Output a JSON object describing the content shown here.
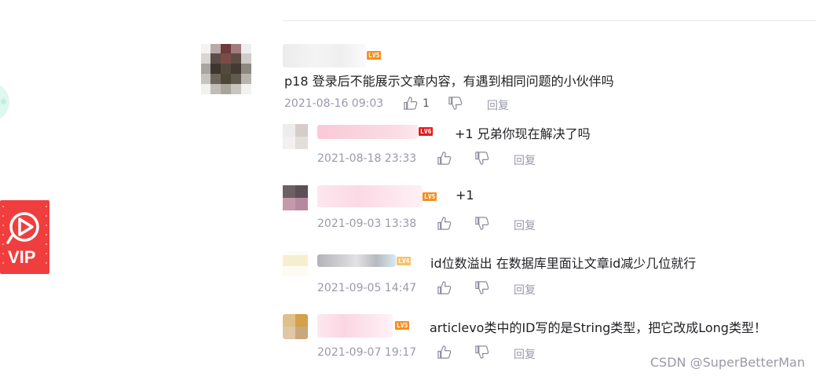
{
  "main_comment": {
    "level": "LV5",
    "text": "p18 登录后不能展示文章内容，有遇到相同问题的小伙伴吗",
    "date": "2021-08-16 09:03",
    "like_count": "1",
    "reply_label": "回复"
  },
  "replies": [
    {
      "level": "LV6",
      "text": "+1 兄弟你现在解决了吗",
      "date": "2021-08-18 23:33",
      "reply_label": "回复"
    },
    {
      "level": "LV5",
      "text": "+1",
      "date": "2021-09-03 13:38",
      "reply_label": "回复"
    },
    {
      "level": "LV4",
      "text": "id位数溢出 在数据库里面让文章id减少几位就行",
      "date": "2021-09-05 14:47",
      "reply_label": "回复"
    },
    {
      "level": "LV5",
      "text": "articlevo类中的ID写的是String类型，把它改成Long类型！",
      "date": "2021-09-07 19:17",
      "reply_label": "回复"
    }
  ],
  "vip": {
    "label": "VIP"
  },
  "watermark": "CSDN @SuperBetterMan",
  "colors": {
    "vip": "#f03e3e",
    "level_orange": "#f58f1f",
    "level_red": "#e41c1c",
    "meta": "#999aaa"
  }
}
